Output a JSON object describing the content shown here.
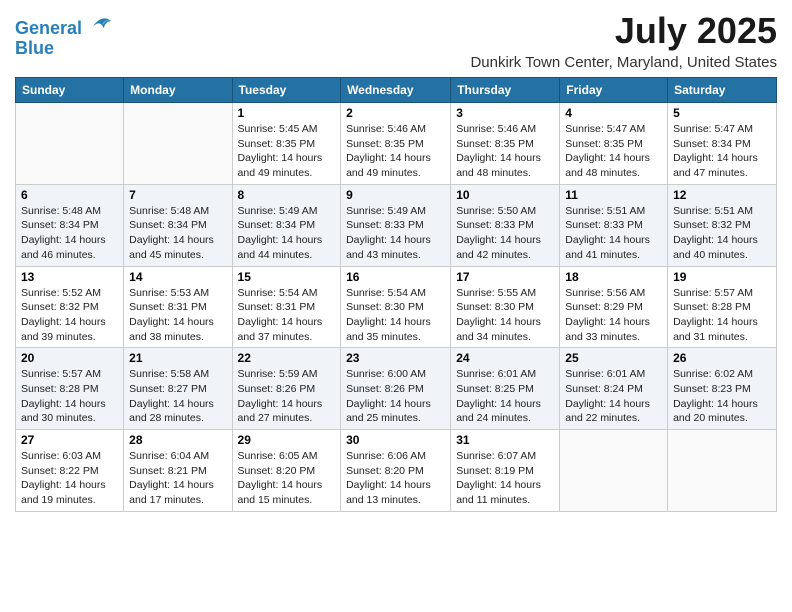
{
  "logo": {
    "line1": "General",
    "line2": "Blue"
  },
  "title": "July 2025",
  "location": "Dunkirk Town Center, Maryland, United States",
  "weekdays": [
    "Sunday",
    "Monday",
    "Tuesday",
    "Wednesday",
    "Thursday",
    "Friday",
    "Saturday"
  ],
  "weeks": [
    [
      {
        "day": "",
        "info": ""
      },
      {
        "day": "",
        "info": ""
      },
      {
        "day": "1",
        "info": "Sunrise: 5:45 AM\nSunset: 8:35 PM\nDaylight: 14 hours and 49 minutes."
      },
      {
        "day": "2",
        "info": "Sunrise: 5:46 AM\nSunset: 8:35 PM\nDaylight: 14 hours and 49 minutes."
      },
      {
        "day": "3",
        "info": "Sunrise: 5:46 AM\nSunset: 8:35 PM\nDaylight: 14 hours and 48 minutes."
      },
      {
        "day": "4",
        "info": "Sunrise: 5:47 AM\nSunset: 8:35 PM\nDaylight: 14 hours and 48 minutes."
      },
      {
        "day": "5",
        "info": "Sunrise: 5:47 AM\nSunset: 8:34 PM\nDaylight: 14 hours and 47 minutes."
      }
    ],
    [
      {
        "day": "6",
        "info": "Sunrise: 5:48 AM\nSunset: 8:34 PM\nDaylight: 14 hours and 46 minutes."
      },
      {
        "day": "7",
        "info": "Sunrise: 5:48 AM\nSunset: 8:34 PM\nDaylight: 14 hours and 45 minutes."
      },
      {
        "day": "8",
        "info": "Sunrise: 5:49 AM\nSunset: 8:34 PM\nDaylight: 14 hours and 44 minutes."
      },
      {
        "day": "9",
        "info": "Sunrise: 5:49 AM\nSunset: 8:33 PM\nDaylight: 14 hours and 43 minutes."
      },
      {
        "day": "10",
        "info": "Sunrise: 5:50 AM\nSunset: 8:33 PM\nDaylight: 14 hours and 42 minutes."
      },
      {
        "day": "11",
        "info": "Sunrise: 5:51 AM\nSunset: 8:33 PM\nDaylight: 14 hours and 41 minutes."
      },
      {
        "day": "12",
        "info": "Sunrise: 5:51 AM\nSunset: 8:32 PM\nDaylight: 14 hours and 40 minutes."
      }
    ],
    [
      {
        "day": "13",
        "info": "Sunrise: 5:52 AM\nSunset: 8:32 PM\nDaylight: 14 hours and 39 minutes."
      },
      {
        "day": "14",
        "info": "Sunrise: 5:53 AM\nSunset: 8:31 PM\nDaylight: 14 hours and 38 minutes."
      },
      {
        "day": "15",
        "info": "Sunrise: 5:54 AM\nSunset: 8:31 PM\nDaylight: 14 hours and 37 minutes."
      },
      {
        "day": "16",
        "info": "Sunrise: 5:54 AM\nSunset: 8:30 PM\nDaylight: 14 hours and 35 minutes."
      },
      {
        "day": "17",
        "info": "Sunrise: 5:55 AM\nSunset: 8:30 PM\nDaylight: 14 hours and 34 minutes."
      },
      {
        "day": "18",
        "info": "Sunrise: 5:56 AM\nSunset: 8:29 PM\nDaylight: 14 hours and 33 minutes."
      },
      {
        "day": "19",
        "info": "Sunrise: 5:57 AM\nSunset: 8:28 PM\nDaylight: 14 hours and 31 minutes."
      }
    ],
    [
      {
        "day": "20",
        "info": "Sunrise: 5:57 AM\nSunset: 8:28 PM\nDaylight: 14 hours and 30 minutes."
      },
      {
        "day": "21",
        "info": "Sunrise: 5:58 AM\nSunset: 8:27 PM\nDaylight: 14 hours and 28 minutes."
      },
      {
        "day": "22",
        "info": "Sunrise: 5:59 AM\nSunset: 8:26 PM\nDaylight: 14 hours and 27 minutes."
      },
      {
        "day": "23",
        "info": "Sunrise: 6:00 AM\nSunset: 8:26 PM\nDaylight: 14 hours and 25 minutes."
      },
      {
        "day": "24",
        "info": "Sunrise: 6:01 AM\nSunset: 8:25 PM\nDaylight: 14 hours and 24 minutes."
      },
      {
        "day": "25",
        "info": "Sunrise: 6:01 AM\nSunset: 8:24 PM\nDaylight: 14 hours and 22 minutes."
      },
      {
        "day": "26",
        "info": "Sunrise: 6:02 AM\nSunset: 8:23 PM\nDaylight: 14 hours and 20 minutes."
      }
    ],
    [
      {
        "day": "27",
        "info": "Sunrise: 6:03 AM\nSunset: 8:22 PM\nDaylight: 14 hours and 19 minutes."
      },
      {
        "day": "28",
        "info": "Sunrise: 6:04 AM\nSunset: 8:21 PM\nDaylight: 14 hours and 17 minutes."
      },
      {
        "day": "29",
        "info": "Sunrise: 6:05 AM\nSunset: 8:20 PM\nDaylight: 14 hours and 15 minutes."
      },
      {
        "day": "30",
        "info": "Sunrise: 6:06 AM\nSunset: 8:20 PM\nDaylight: 14 hours and 13 minutes."
      },
      {
        "day": "31",
        "info": "Sunrise: 6:07 AM\nSunset: 8:19 PM\nDaylight: 14 hours and 11 minutes."
      },
      {
        "day": "",
        "info": ""
      },
      {
        "day": "",
        "info": ""
      }
    ]
  ]
}
